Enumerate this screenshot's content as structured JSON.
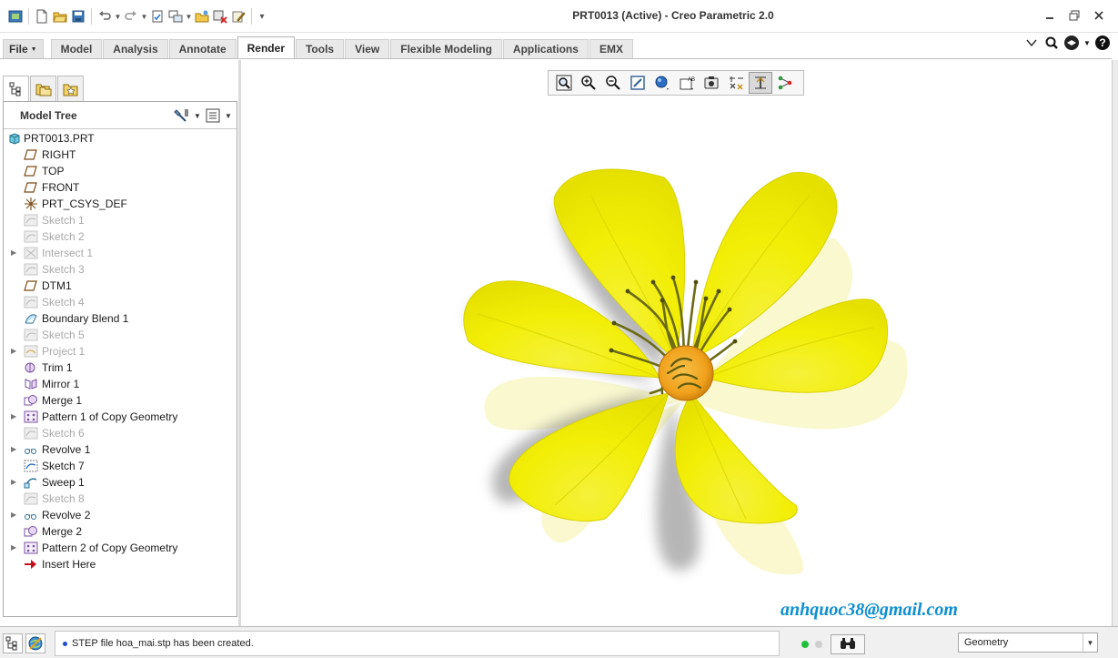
{
  "window": {
    "title": "PRT0013 (Active) - Creo Parametric 2.0",
    "quick_access": [
      "app-icon",
      "new-icon",
      "open-icon",
      "save-icon",
      "undo-icon",
      "redo-icon",
      "regenerate-icon",
      "windows-icon",
      "open-folder-icon",
      "close-window-icon",
      "edit-icon",
      "customize-icon"
    ],
    "controls": [
      "minimize-icon",
      "restore-icon",
      "close-icon"
    ]
  },
  "ribbon": {
    "file_label": "File",
    "tabs": [
      "Model",
      "Analysis",
      "Annotate",
      "Render",
      "Tools",
      "View",
      "Flexible Modeling",
      "Applications",
      "EMX"
    ],
    "active_tab": "Render",
    "right_controls": [
      "collapse-ribbon-icon",
      "search-icon",
      "help-center-icon",
      "help-icon"
    ]
  },
  "navigator": {
    "tabs": [
      "model-tree-icon",
      "folder-browser-icon",
      "favorites-icon"
    ],
    "header": "Model Tree",
    "tools": [
      "tree-settings-icon",
      "tree-columns-icon"
    ],
    "items": [
      {
        "label": "PRT0013.PRT",
        "icon": "part-icon",
        "level": 0,
        "expand": false,
        "dim": false
      },
      {
        "label": "RIGHT",
        "icon": "datum-plane-icon",
        "level": 1,
        "expand": false,
        "dim": false
      },
      {
        "label": "TOP",
        "icon": "datum-plane-icon",
        "level": 1,
        "expand": false,
        "dim": false
      },
      {
        "label": "FRONT",
        "icon": "datum-plane-icon",
        "level": 1,
        "expand": false,
        "dim": false
      },
      {
        "label": "PRT_CSYS_DEF",
        "icon": "csys-icon",
        "level": 1,
        "expand": false,
        "dim": false
      },
      {
        "label": "Sketch 1",
        "icon": "sketch-icon",
        "level": 1,
        "expand": false,
        "dim": true
      },
      {
        "label": "Sketch 2",
        "icon": "sketch-icon",
        "level": 1,
        "expand": false,
        "dim": true
      },
      {
        "label": "Intersect 1",
        "icon": "intersect-icon",
        "level": 1,
        "expand": true,
        "dim": true
      },
      {
        "label": "Sketch 3",
        "icon": "sketch-icon",
        "level": 1,
        "expand": false,
        "dim": true
      },
      {
        "label": "DTM1",
        "icon": "datum-plane-icon",
        "level": 1,
        "expand": false,
        "dim": false
      },
      {
        "label": "Sketch 4",
        "icon": "sketch-icon",
        "level": 1,
        "expand": false,
        "dim": true
      },
      {
        "label": "Boundary Blend 1",
        "icon": "boundary-blend-icon",
        "level": 1,
        "expand": false,
        "dim": false
      },
      {
        "label": "Sketch 5",
        "icon": "sketch-icon",
        "level": 1,
        "expand": false,
        "dim": true
      },
      {
        "label": "Project 1",
        "icon": "project-icon",
        "level": 1,
        "expand": true,
        "dim": true
      },
      {
        "label": "Trim 1",
        "icon": "trim-icon",
        "level": 1,
        "expand": false,
        "dim": false
      },
      {
        "label": "Mirror 1",
        "icon": "mirror-icon",
        "level": 1,
        "expand": false,
        "dim": false
      },
      {
        "label": "Merge 1",
        "icon": "merge-icon",
        "level": 1,
        "expand": false,
        "dim": false
      },
      {
        "label": "Pattern 1 of Copy Geometry",
        "icon": "pattern-icon",
        "level": 1,
        "expand": true,
        "dim": false
      },
      {
        "label": "Sketch 6",
        "icon": "sketch-icon",
        "level": 1,
        "expand": false,
        "dim": true
      },
      {
        "label": "Revolve 1",
        "icon": "revolve-icon",
        "level": 1,
        "expand": true,
        "dim": false
      },
      {
        "label": "Sketch 7",
        "icon": "sketch-active-icon",
        "level": 1,
        "expand": false,
        "dim": false
      },
      {
        "label": "Sweep 1",
        "icon": "sweep-icon",
        "level": 1,
        "expand": true,
        "dim": false
      },
      {
        "label": "Sketch 8",
        "icon": "sketch-icon",
        "level": 1,
        "expand": false,
        "dim": true
      },
      {
        "label": "Revolve 2",
        "icon": "revolve-icon",
        "level": 1,
        "expand": true,
        "dim": false
      },
      {
        "label": "Merge 2",
        "icon": "merge-icon",
        "level": 1,
        "expand": false,
        "dim": false
      },
      {
        "label": "Pattern 2 of Copy Geometry",
        "icon": "pattern-icon",
        "level": 1,
        "expand": true,
        "dim": false
      },
      {
        "label": "Insert Here",
        "icon": "insert-here-icon",
        "level": 1,
        "expand": false,
        "dim": false
      }
    ]
  },
  "view_toolbar": {
    "buttons": [
      "refit-icon",
      "zoom-in-icon",
      "zoom-out-icon",
      "repaint-icon",
      "display-style-icon",
      "saved-orientations-icon",
      "view-manager-icon",
      "perspective-icon",
      "datum-display-filters-icon",
      "annotation-display-icon"
    ],
    "active": "datum-display-filters-icon"
  },
  "graphics": {
    "watermark": "anhquoc38@gmail.com",
    "colors": {
      "petal": "#f2ee06",
      "petal_shade": "#d8d200",
      "petal_ghost": "#f7f3a8",
      "center": "#f0a11c",
      "stamen": "#6b6a16"
    }
  },
  "statusbar": {
    "message": "STEP file hoa_mai.stp has been created.",
    "filter_value": "Geometry",
    "icons": [
      "model-tree-toggle-icon",
      "browser-toggle-icon",
      "find-icon"
    ],
    "leds": [
      "#20c13a",
      "#cfcfcf"
    ]
  }
}
